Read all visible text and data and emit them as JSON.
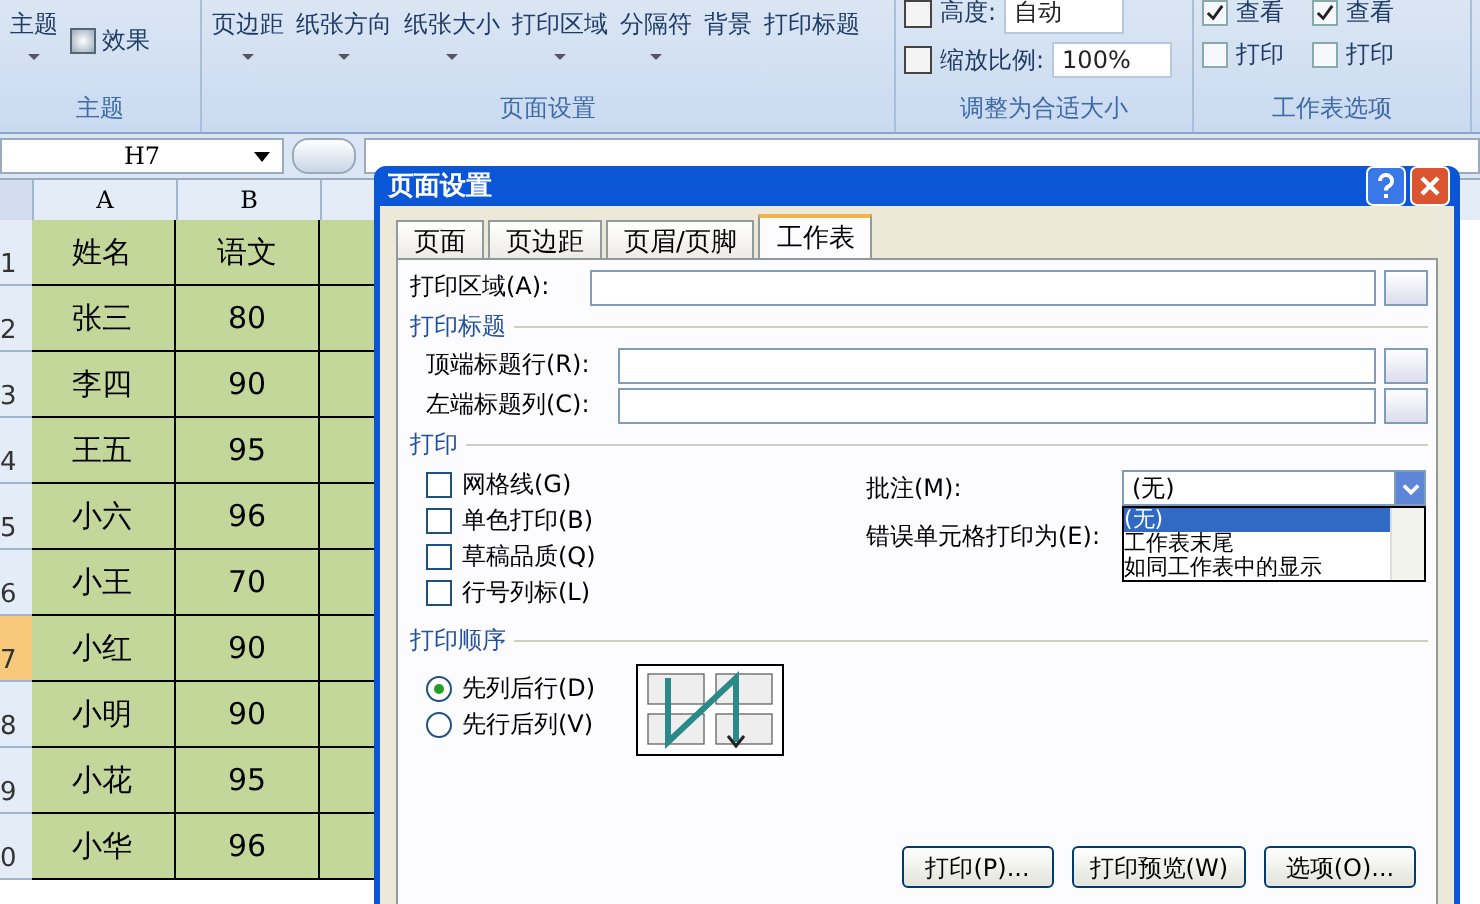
{
  "ribbon": {
    "theme_group": {
      "label": "主题",
      "buttons": [
        "主题",
        "效果"
      ]
    },
    "page_setup_group": {
      "label": "页面设置",
      "buttons": [
        {
          "label": "页边距",
          "dropdown": true
        },
        {
          "label": "纸张方向",
          "dropdown": true
        },
        {
          "label": "纸张大小",
          "dropdown": true
        },
        {
          "label": "打印区域",
          "dropdown": true
        },
        {
          "label": "分隔符",
          "dropdown": true
        },
        {
          "label": "背景",
          "dropdown": false
        },
        {
          "label": "打印标题",
          "dropdown": false
        }
      ]
    },
    "scale_group": {
      "label": "调整为合适大小",
      "height_label": "高度:",
      "height_value": "自动",
      "scale_label": "缩放比例:",
      "scale_value": "100%"
    },
    "sheet_options_group": {
      "label": "工作表选项",
      "columns": [
        {
          "items": [
            {
              "label": "查看",
              "checked": true
            },
            {
              "label": "打印",
              "checked": false
            }
          ]
        },
        {
          "items": [
            {
              "label": "查看",
              "checked": true
            },
            {
              "label": "打印",
              "checked": false
            }
          ]
        }
      ]
    }
  },
  "formula_bar": {
    "name_box": "H7"
  },
  "sheet": {
    "columns": [
      "A",
      "B"
    ],
    "rows": [
      {
        "number": "1",
        "selected": false,
        "cells": [
          "姓名",
          "语文"
        ]
      },
      {
        "number": "2",
        "selected": false,
        "cells": [
          "张三",
          "80"
        ]
      },
      {
        "number": "3",
        "selected": false,
        "cells": [
          "李四",
          "90"
        ]
      },
      {
        "number": "4",
        "selected": false,
        "cells": [
          "王五",
          "95"
        ]
      },
      {
        "number": "5",
        "selected": false,
        "cells": [
          "小六",
          "96"
        ]
      },
      {
        "number": "6",
        "selected": false,
        "cells": [
          "小王",
          "70"
        ]
      },
      {
        "number": "7",
        "selected": true,
        "cells": [
          "小红",
          "90"
        ]
      },
      {
        "number": "8",
        "selected": false,
        "cells": [
          "小明",
          "90"
        ]
      },
      {
        "number": "9",
        "selected": false,
        "cells": [
          "小花",
          "95"
        ]
      },
      {
        "number": "0",
        "selected": false,
        "cells": [
          "小华",
          "96"
        ]
      }
    ]
  },
  "dialog": {
    "title": "页面设置",
    "tabs": [
      {
        "label": "页面",
        "selected": false
      },
      {
        "label": "页边距",
        "selected": false
      },
      {
        "label": "页眉/页脚",
        "selected": false
      },
      {
        "label": "工作表",
        "selected": true
      }
    ],
    "print_area": {
      "label": "打印区域(A):"
    },
    "print_titles": {
      "heading": "打印标题",
      "fields": [
        {
          "label": "顶端标题行(R):"
        },
        {
          "label": "左端标题列(C):"
        }
      ]
    },
    "print": {
      "heading": "打印",
      "checkboxes": [
        {
          "label": "网格线(G)",
          "checked": false
        },
        {
          "label": "单色打印(B)",
          "checked": false
        },
        {
          "label": "草稿品质(Q)",
          "checked": false
        },
        {
          "label": "行号列标(L)",
          "checked": false
        }
      ],
      "comments": {
        "label": "批注(M):",
        "value": "(无)",
        "expanded": true,
        "options": [
          {
            "label": "(无)",
            "selected": true
          },
          {
            "label": "工作表末尾",
            "selected": false
          },
          {
            "label": "如同工作表中的显示",
            "selected": false
          }
        ]
      },
      "errors": {
        "label": "错误单元格打印为(E):"
      }
    },
    "order": {
      "heading": "打印顺序",
      "options": [
        {
          "label": "先列后行(D)",
          "selected": true
        },
        {
          "label": "先行后列(V)",
          "selected": false
        }
      ]
    },
    "buttons": [
      "打印(P)...",
      "打印预览(W)",
      "选项(O)..."
    ]
  }
}
